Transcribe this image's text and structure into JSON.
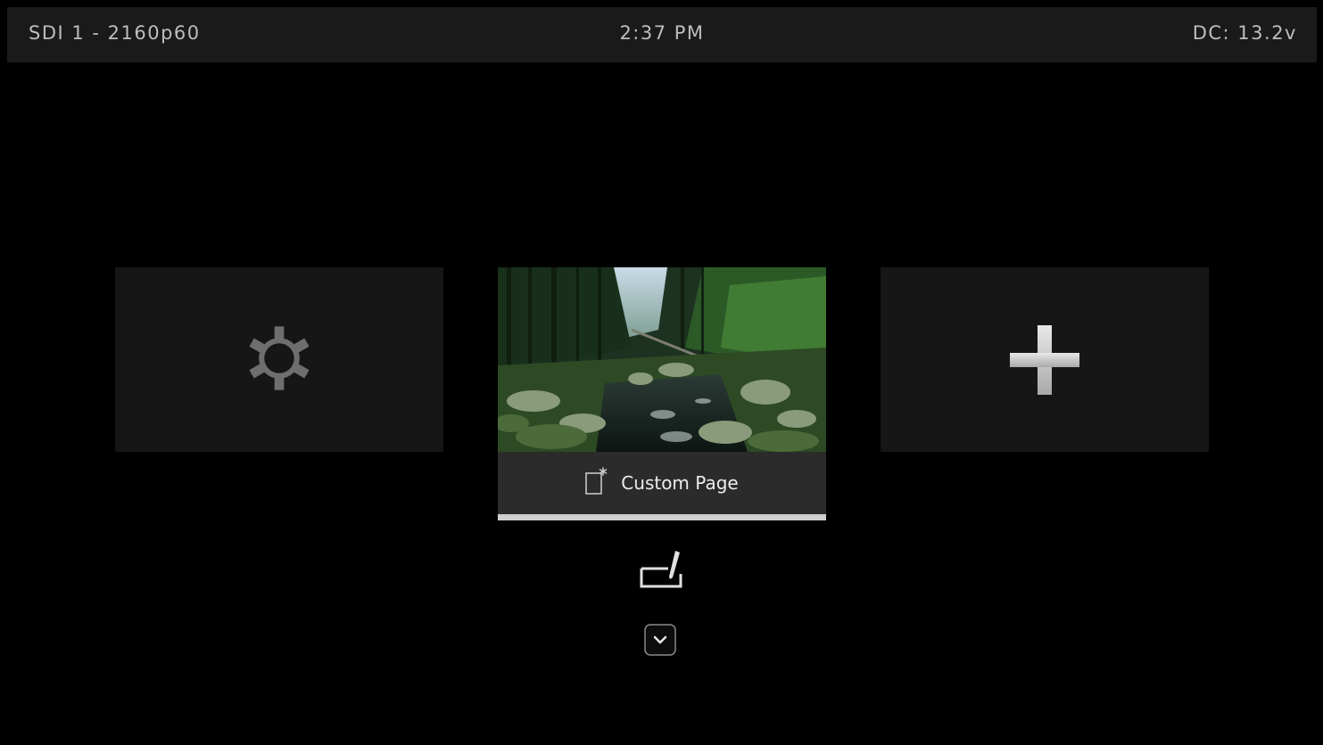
{
  "status_bar": {
    "input": "SDI 1 - 2160p60",
    "time": "2:37 PM",
    "power": "DC: 13.2v"
  },
  "tiles": {
    "settings": {
      "icon": "gear-icon"
    },
    "custom_page": {
      "icon": "page-star-icon",
      "label": "Custom Page",
      "selected": true
    },
    "add": {
      "icon": "plus-icon"
    }
  },
  "controls": {
    "edit": {
      "icon": "edit-icon"
    },
    "expand": {
      "icon": "chevron-down-icon"
    }
  },
  "colors": {
    "status_bg": "#1a1a1a",
    "tile_bg": "#161616",
    "caption_bg": "#2b2b2b",
    "selection": "#cfcfcf",
    "icon_gray": "#6e6e6e"
  }
}
